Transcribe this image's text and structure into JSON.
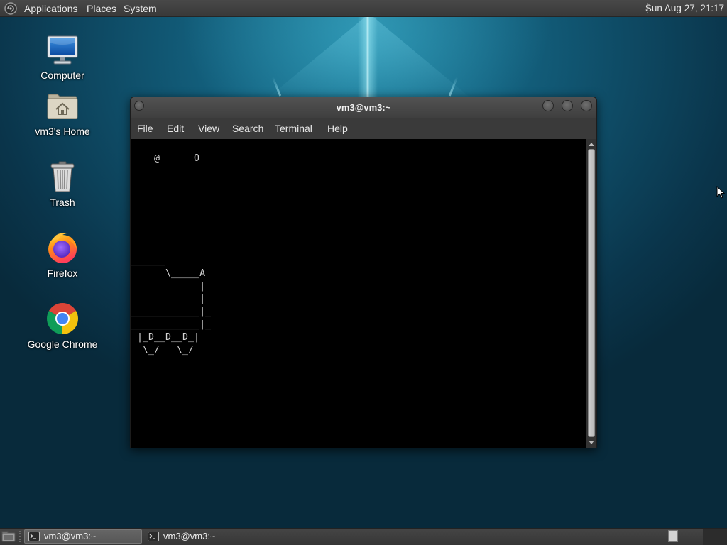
{
  "top_panel": {
    "logo_icon": "distro-logo-icon",
    "menus": [
      "Applications",
      "Places",
      "System"
    ],
    "clock": "Sun Aug 27, 21:17"
  },
  "desktop_icons": [
    {
      "label": "Computer",
      "icon": "computer-icon"
    },
    {
      "label": "vm3's Home",
      "icon": "home-folder-icon"
    },
    {
      "label": "Trash",
      "icon": "trash-icon"
    },
    {
      "label": "Firefox",
      "icon": "firefox-icon"
    },
    {
      "label": "Google Chrome",
      "icon": "chrome-icon"
    }
  ],
  "terminal": {
    "title": "vm3@vm3:~",
    "menu": [
      "File",
      "Edit",
      "View",
      "Search",
      "Terminal",
      "Help"
    ],
    "lines": [
      "",
      "    @      O",
      "",
      "",
      "",
      "",
      "",
      "",
      "",
      "______",
      "      \\_____A",
      "            |",
      "            |",
      "____________|_",
      "____________|_",
      " |_D__D__D_|",
      "  \\_/   \\_/"
    ]
  },
  "taskbar": {
    "items": [
      {
        "label": "vm3@vm3:~",
        "icon": "terminal-icon",
        "active": true
      },
      {
        "label": "vm3@vm3:~",
        "icon": "terminal-icon",
        "active": false
      }
    ]
  },
  "colors": {
    "panel": "#3c3c3c",
    "terminal_bg": "#000000",
    "terminal_fg": "#d3d3d3",
    "wallpaper": "#0e4a64"
  }
}
